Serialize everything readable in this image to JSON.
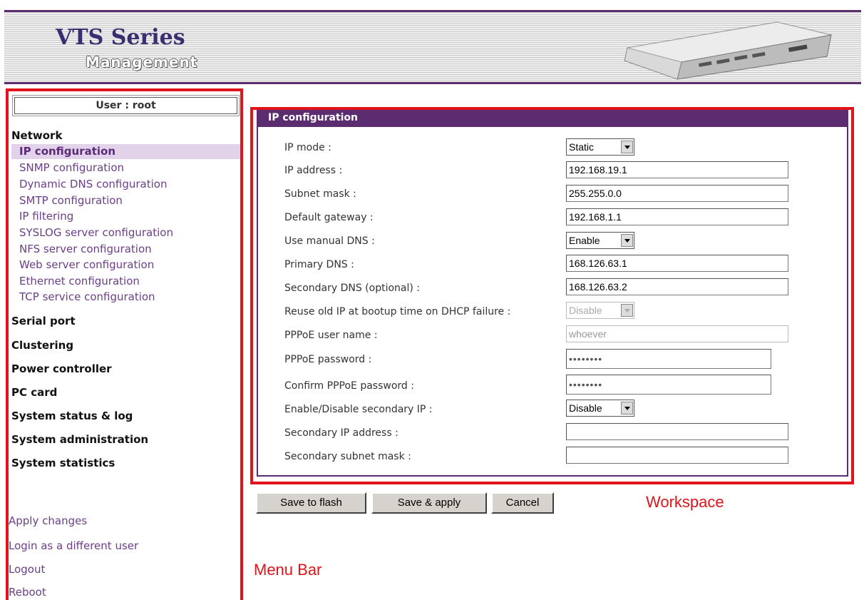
{
  "header": {
    "brand_main": "VTS Series",
    "brand_sub": "Management",
    "device_image": "device-chassis"
  },
  "annotations": {
    "menu_bar": "Menu Bar",
    "workspace": "Workspace",
    "color": "#e0141a"
  },
  "sidebar": {
    "user": "User : root",
    "sections": {
      "network": "Network",
      "serial_port": "Serial port",
      "clustering": "Clustering",
      "power_controller": "Power controller",
      "pc_card": "PC card",
      "system_status": "System status & log",
      "system_admin": "System administration",
      "system_stats": "System statistics"
    },
    "network_items": [
      {
        "label": "IP configuration",
        "active": true
      },
      {
        "label": "SNMP configuration"
      },
      {
        "label": "Dynamic DNS configuration"
      },
      {
        "label": "SMTP configuration"
      },
      {
        "label": "IP filtering"
      },
      {
        "label": "SYSLOG server configuration"
      },
      {
        "label": "NFS server configuration"
      },
      {
        "label": "Web server configuration"
      },
      {
        "label": "Ethernet configuration"
      },
      {
        "label": "TCP service configuration"
      }
    ],
    "bottom_links": {
      "apply": "Apply changes",
      "login": "Login as a different user",
      "logout": "Logout",
      "reboot": "Reboot"
    }
  },
  "panel": {
    "title": "IP configuration",
    "fields": {
      "ip_mode": {
        "label": "IP mode :",
        "value": "Static"
      },
      "ip_address": {
        "label": "IP address :",
        "value": "192.168.19.1"
      },
      "subnet_mask": {
        "label": "Subnet mask :",
        "value": "255.255.0.0"
      },
      "gateway": {
        "label": "Default gateway :",
        "value": "192.168.1.1"
      },
      "manual_dns": {
        "label": "Use manual DNS :",
        "value": "Enable"
      },
      "primary_dns": {
        "label": "Primary DNS :",
        "value": "168.126.63.1"
      },
      "secondary_dns": {
        "label": "Secondary DNS (optional) :",
        "value": "168.126.63.2"
      },
      "reuse_ip": {
        "label": "Reuse old IP at bootup time on DHCP failure :",
        "value": "Disable"
      },
      "pppoe_user": {
        "label": "PPPoE user name :",
        "value": "whoever"
      },
      "pppoe_pwd": {
        "label": "PPPoE password :",
        "value": "••••••••"
      },
      "pppoe_confirm": {
        "label": "Confirm PPPoE password :",
        "value": "••••••••"
      },
      "secondary_ip_toggle": {
        "label": "Enable/Disable secondary IP :",
        "value": "Disable"
      },
      "secondary_ip": {
        "label": "Secondary IP address :",
        "value": ""
      },
      "secondary_mask": {
        "label": "Secondary subnet mask :",
        "value": ""
      }
    }
  },
  "buttons": {
    "save_flash": "Save to flash",
    "save_apply": "Save & apply",
    "cancel": "Cancel"
  }
}
